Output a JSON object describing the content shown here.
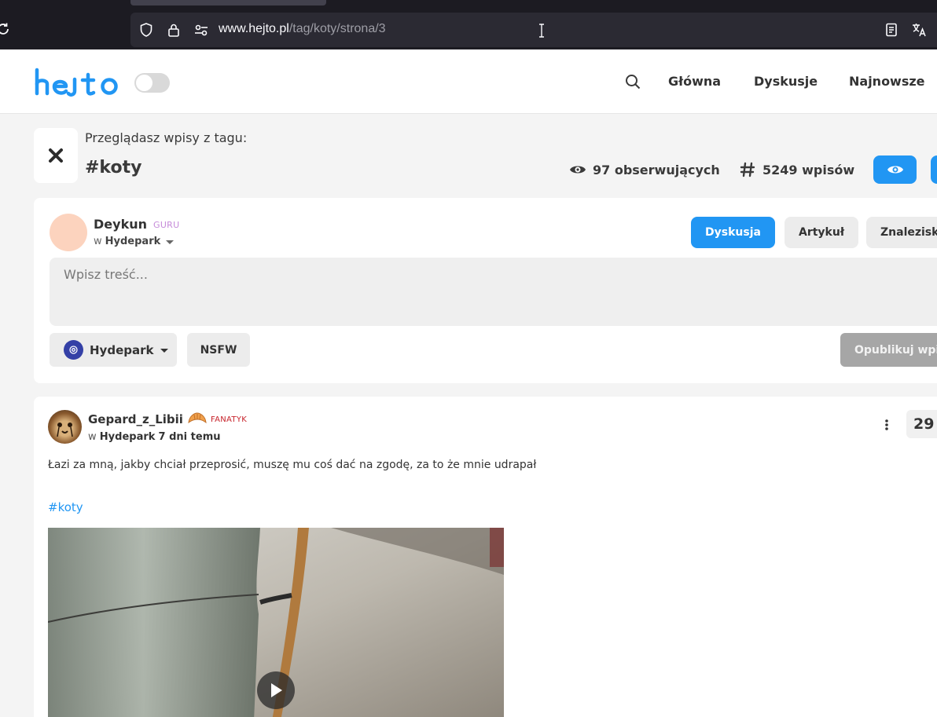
{
  "browser": {
    "url_host": "www.hejto.pl",
    "url_path": "/tag/koty/strona/3"
  },
  "header": {
    "logo_text": "hejto",
    "nav": [
      {
        "label": "Główna"
      },
      {
        "label": "Dyskusje"
      },
      {
        "label": "Najnowsze"
      }
    ]
  },
  "tag_header": {
    "caption": "Przeglądasz wpisy z tagu:",
    "tag": "#koty",
    "followers": "97 obserwujących",
    "posts": "5249 wpisów"
  },
  "composer": {
    "username": "Deykun",
    "rank": "GURU",
    "place_prefix": "w",
    "place": "Hydepark",
    "types": [
      {
        "label": "Dyskusja",
        "active": true
      },
      {
        "label": "Artykuł",
        "active": false
      },
      {
        "label": "Znalezisko",
        "active": false
      }
    ],
    "placeholder": "Wpisz treść...",
    "community": "Hydepark",
    "nsfw": "NSFW",
    "publish": "Opublikuj wpis"
  },
  "post": {
    "username": "Gepard_z_Libii",
    "rank": "FANATYK",
    "place_prefix": "w",
    "place": "Hydepark",
    "time": "7 dni temu",
    "score": "29",
    "text": "Łazi za mną, jakby chciał przeprosić, muszę mu coś dać na zgodę, za to że mnie udrapał",
    "tag": "#koty"
  },
  "icons": {
    "reload": "reload-icon",
    "shield": "shield-icon",
    "lock": "lock-icon",
    "permissions": "permissions-icon",
    "reader": "reader-view-icon",
    "translate": "translate-icon",
    "search": "search-icon",
    "close": "close-icon",
    "eye": "eye-icon",
    "hash": "hash-icon",
    "chevron": "chevron-down-icon",
    "more": "more-vertical-icon",
    "play": "play-icon"
  },
  "colors": {
    "accent": "#2196f3",
    "rank_guru": "#c68bd9",
    "rank_fanatyk": "#c7232b"
  }
}
